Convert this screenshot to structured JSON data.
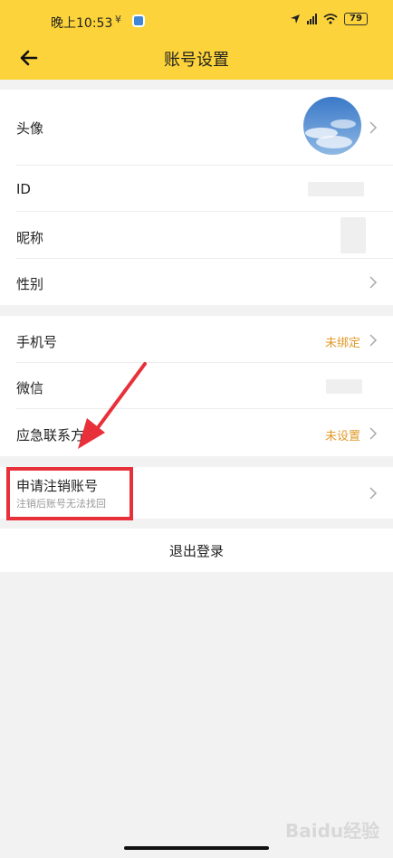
{
  "status_bar": {
    "time": "晚上10:53",
    "extra_glyph": "¥",
    "signal_text": "HD",
    "battery": "79"
  },
  "header": {
    "title": "账号设置",
    "back_icon": "arrow-left-icon",
    "background": "#fcd33a"
  },
  "profile_group": {
    "avatar_label": "头像",
    "id_label": "ID",
    "nickname_label": "昵称",
    "gender_label": "性别"
  },
  "binding_group": {
    "phone_label": "手机号",
    "phone_value": "未绑定",
    "wechat_label": "微信",
    "emergency_label": "应急联系方",
    "emergency_value": "未设置"
  },
  "cancel_account": {
    "title": "申请注销账号",
    "subtitle": "注销后账号无法找回"
  },
  "logout": {
    "label": "退出登录"
  },
  "watermark": "Baidu经验",
  "colors": {
    "accent": "#fcd33a",
    "status_value": "#e09a2b",
    "annotation": "#e8303a"
  }
}
